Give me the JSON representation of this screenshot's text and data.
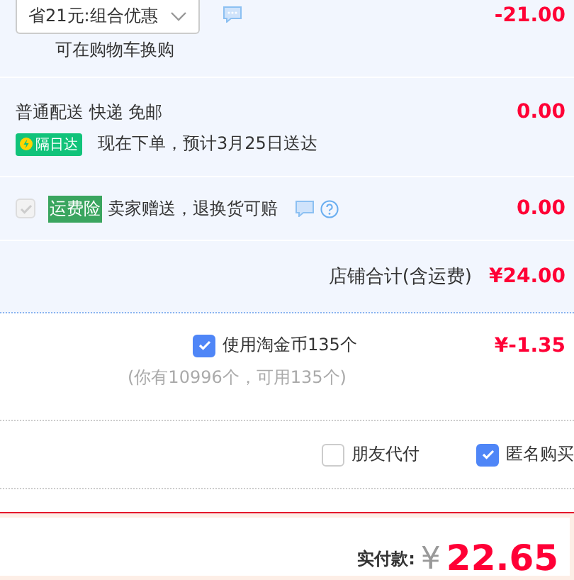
{
  "promo": {
    "select": "省21元:组合优惠",
    "note": "可在购物车换购",
    "amount": "-21.00"
  },
  "delivery": {
    "method": "普通配送 快递 免邮",
    "badge": "隔日达",
    "eta": "现在下单，预计3月25日送达",
    "amount": "0.00"
  },
  "insurance": {
    "checked": true,
    "disabled": true,
    "tag": "运费险",
    "text": "卖家赠送，退换货可赔",
    "amount": "0.00"
  },
  "shop_total": {
    "label": "店铺合计(含运费)",
    "amount": "¥24.00"
  },
  "coins": {
    "checked": true,
    "label": "使用淘金币135个",
    "amount": "¥-1.35",
    "note": "(你有10996个，可用135个)"
  },
  "options": [
    {
      "label": "朋友代付",
      "checked": false
    },
    {
      "label": "匿名购买",
      "checked": true
    }
  ],
  "total": {
    "label": "实付款:",
    "currency": "¥",
    "amount": "22.65"
  }
}
